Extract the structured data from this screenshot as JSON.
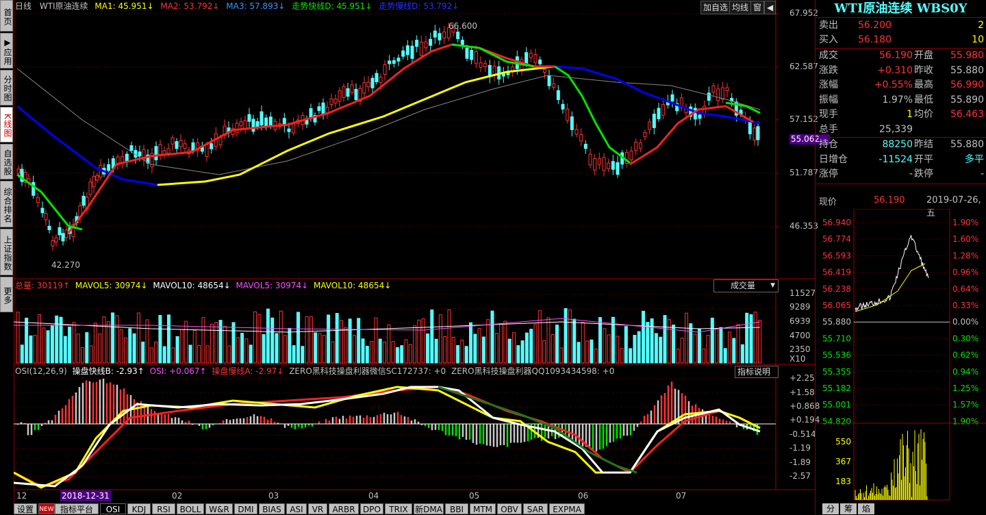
{
  "colors": {
    "up": "#ff3232",
    "down": "#54ffff",
    "bg": "#000000",
    "grid": "#800000",
    "white": "#ffffff",
    "yellow": "#ffff00",
    "green": "#00e600",
    "blue": "#0000ff",
    "magenta": "#ff50ff"
  },
  "left_tabs": [
    {
      "label": "首页",
      "icon": "home-icon"
    },
    {
      "label": "▶应用",
      "icon": "play-icon"
    },
    {
      "label": "分时图",
      "icon": "timeline-icon"
    },
    {
      "label": "K线图",
      "icon": "kline-icon",
      "active": true
    },
    {
      "label": "自选股",
      "icon": "watchlist-icon"
    },
    {
      "label": "综合排名",
      "icon": "rank-icon"
    },
    {
      "label": "上证指数",
      "icon": "index-icon"
    },
    {
      "label": "更多",
      "icon": "more-icon"
    }
  ],
  "main_legend": {
    "period": "日线",
    "name": "WTI原油连续",
    "ma1": "MA1: 45.951↓",
    "ma2": "MA2: 53.792↓",
    "ma3": "MA3: 57.893↓",
    "fastD": "走势快线D: 45.951↓",
    "slowD": "走势慢线D: 53.792↓"
  },
  "top_buttons": {
    "add": "加自选",
    "ma": "均线",
    "window": "窗",
    "back": "◀"
  },
  "price_axis": [
    "67.952",
    "62.587",
    "57.152",
    "51.787",
    "46.353"
  ],
  "current_price_tag": "55.062",
  "annotations": {
    "high": "66.600",
    "low": "42.270"
  },
  "volume_legend": {
    "total": "总量: 30119↑",
    "mavol5": "MAVOL5: 30974↓",
    "mavol10": "MAVOL10: 48654↓",
    "mavol5b": "MAVOL5: 30974↓",
    "mavol10b": "MAVOL10: 48654↓"
  },
  "volume_dropdown": "成交量",
  "volume_axis": [
    "11527",
    "9289",
    "6939",
    "4700",
    "2350",
    "X10"
  ],
  "osi_legend": {
    "name": "OSI(12,26,9)",
    "fastB": "操盘快线B: -2.93↑",
    "osi": "OSI: +0.067↑",
    "slowA": "操盘慢线A: -2.97↓",
    "zero1": "ZERO黑科技操盘利器微信SC172737: +0",
    "zero2": "ZERO黑科技操盘利器QQ1093434598: +0"
  },
  "osi_help": "指标说明",
  "osi_axis": [
    "+2.25",
    "+1.58",
    "+0.868",
    "+0.194",
    "-0.514",
    "-1.19",
    "-1.89",
    "-2.57"
  ],
  "x_axis": [
    "12",
    "2018-12-31",
    "02",
    "03",
    "04",
    "05",
    "06",
    "07"
  ],
  "bottom_tabs": [
    "设置",
    "指标平台",
    "OSI",
    "KDJ",
    "RSI",
    "BOLL",
    "W&R",
    "DMI",
    "BIAS",
    "ASI",
    "VR",
    "ARBR",
    "DPO",
    "TRIX",
    "新DMA",
    "BBI",
    "MTM",
    "OBV",
    "SAR",
    "EXPMA"
  ],
  "bottom_new_badge": "NEW",
  "right_panel": {
    "title": "WTI原油连续 WBS0Y",
    "sell": {
      "label": "卖出",
      "price": "56.200",
      "qty": "2"
    },
    "buy": {
      "label": "买入",
      "price": "56.180",
      "qty": "10"
    },
    "rows": [
      {
        "l1": "成交",
        "v1": "56.190",
        "l2": "开盘",
        "v2": "55.980"
      },
      {
        "l1": "涨跌",
        "v1": "+0.310",
        "l2": "昨收",
        "v2": "55.880"
      },
      {
        "l1": "涨幅",
        "v1": "+0.55%",
        "l2": "最高",
        "v2": "56.990"
      },
      {
        "l1": "振幅",
        "v1": "1.97%",
        "l2": "最低",
        "v2": "55.890"
      },
      {
        "l1": "现手",
        "v1": "1",
        "l2": "均价",
        "v2": "56.463"
      },
      {
        "l1": "总手",
        "v1": "25,339",
        "l2": "",
        "v2": ""
      }
    ],
    "rows2": [
      {
        "l1": "持仓",
        "v1": "88250",
        "l2": "昨结",
        "v2": "55.880"
      },
      {
        "l1": "日增仓",
        "v1": "-11524",
        "l2": "开平",
        "v2": "多平"
      },
      {
        "l1": "涨停",
        "v1": "-",
        "l2": "跌停",
        "v2": "-"
      }
    ],
    "now_label": "现价",
    "now_price": "56.190",
    "date": "2019-07-26,五",
    "mini_left_axis": [
      "56.940",
      "56.774",
      "56.593",
      "56.419",
      "56.238",
      "56.065",
      "55.880",
      "55.710",
      "55.536",
      "55.355",
      "55.182",
      "55.001",
      "54.820"
    ],
    "mini_right_axis": [
      "1.90%",
      "1.60%",
      "1.28%",
      "0.96%",
      "0.64%",
      "0.33%",
      "0.00%",
      "0.30%",
      "0.62%",
      "0.94%",
      "1.25%",
      "1.57%",
      "1.90%"
    ],
    "mini_vol_axis": [
      "550",
      "367",
      "183"
    ],
    "bottom_tabs": [
      "分",
      "筹",
      "焰"
    ]
  }
}
